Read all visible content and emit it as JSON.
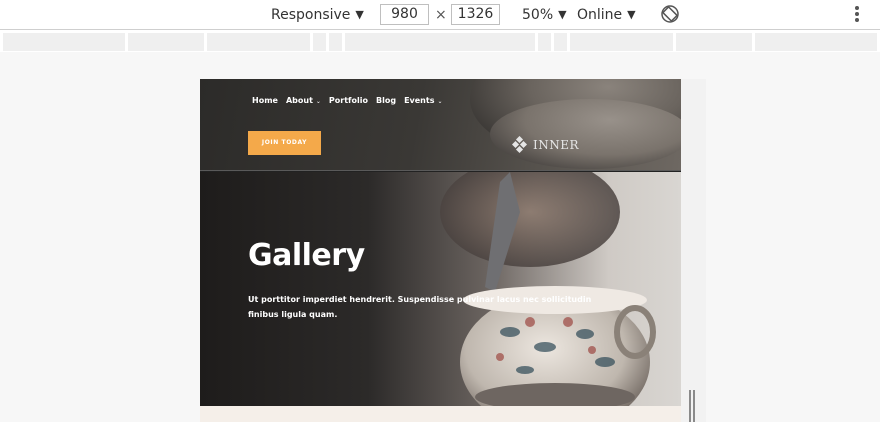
{
  "devtools": {
    "device_label": "Responsive",
    "width_value": "980",
    "times_sign": "×",
    "height_value": "1326",
    "zoom_label": "50%",
    "throttle_label": "Online",
    "caret": "▼"
  },
  "site": {
    "nav": [
      {
        "label": "Home",
        "has_menu": false
      },
      {
        "label": "About",
        "has_menu": true
      },
      {
        "label": "Portfolio",
        "has_menu": false
      },
      {
        "label": "Blog",
        "has_menu": false
      },
      {
        "label": "Events",
        "has_menu": true
      }
    ],
    "nav_caret": "⌄",
    "join_button": "JOIN TODAY",
    "logo_text": "INNER",
    "hero_title": "Gallery",
    "hero_text": "Ut porttitor imperdiet hendrerit. Suspendisse pulvinar lacus nec sollicitudin finibus ligula quam."
  },
  "colors": {
    "accent": "#f4a94a",
    "toolbar_text": "#333333",
    "hero_text": "#ffffff",
    "ruler": "#efefef"
  },
  "icons": [
    "caret-down-icon",
    "rotate-icon",
    "kebab-menu-icon",
    "logo-diamond-icon"
  ]
}
